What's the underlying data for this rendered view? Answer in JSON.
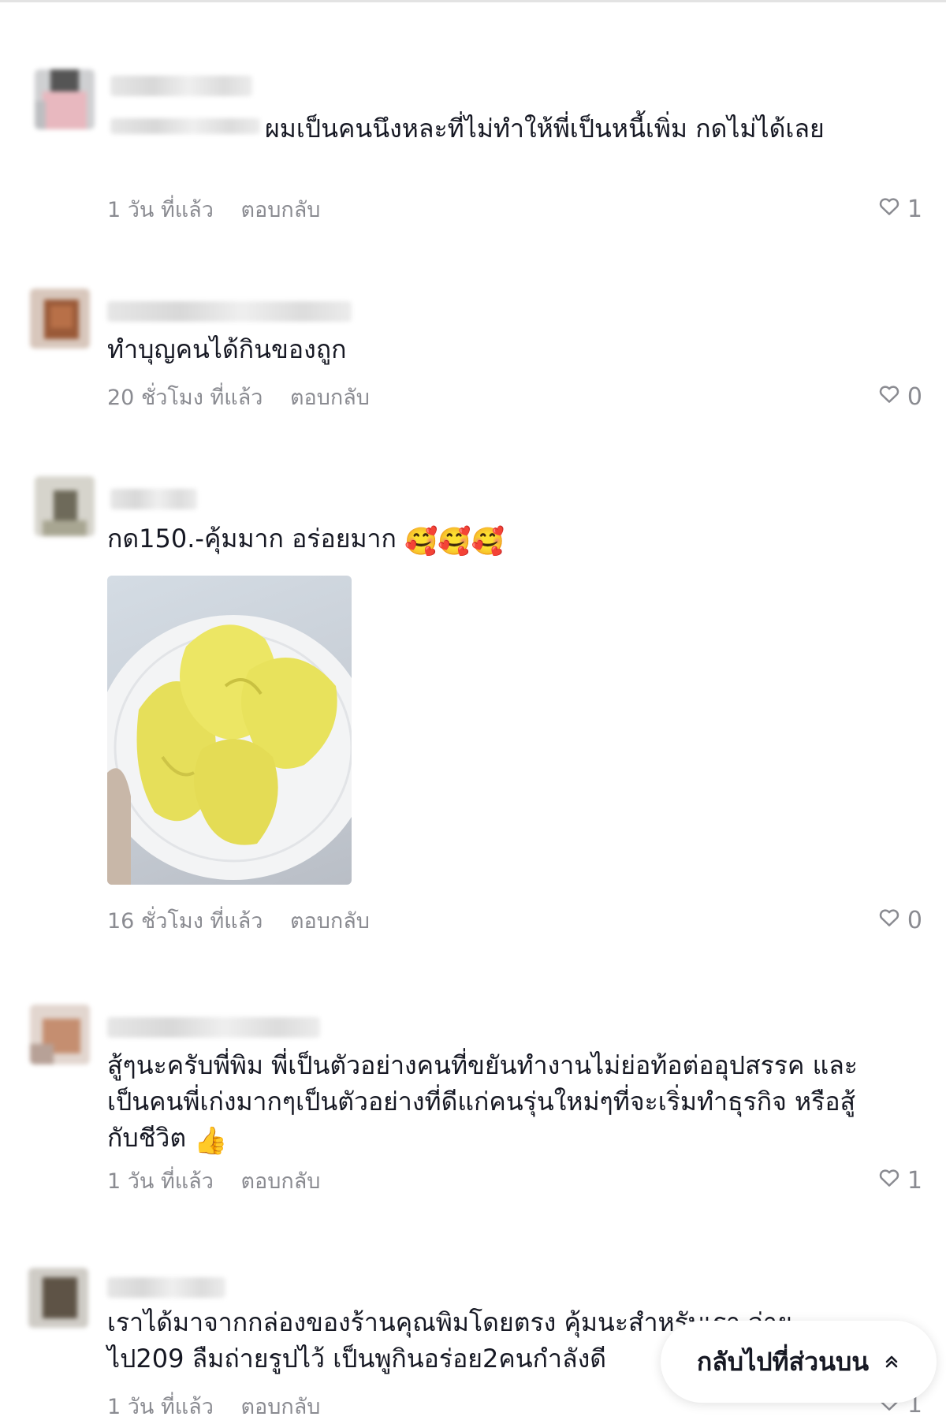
{
  "comments": [
    {
      "text": "ผมเป็นคนนึงหละที่ไม่ทำให้พี่เป็นหนี้เพิ่ม กดไม่ได้เลย",
      "time": "1 วัน ที่แล้ว",
      "reply_label": "ตอบกลับ",
      "likes": "1"
    },
    {
      "text": "ทำบุญคนได้กินของถูก",
      "time": "20 ชั่วโมง ที่แล้ว",
      "reply_label": "ตอบกลับ",
      "likes": "0"
    },
    {
      "text": "กด150.-คุ้มมาก อร่อยมาก",
      "emojis": "🥰🥰🥰",
      "time": "16 ชั่วโมง ที่แล้ว",
      "reply_label": "ตอบกลับ",
      "likes": "0"
    },
    {
      "text": "สู้ๆนะครับพี่พิม พี่เป็นตัวอย่างคนที่ขยันทำงานไม่ย่อท้อต่ออุปสรรค และเป็นคนพี่เก่งมากๆเป็นตัวอย่างที่ดีแก่คนรุ่นใหม่ๆที่จะเริ่มทำธุรกิจ หรือสู้กับชีวิต",
      "emojis": "👍",
      "time": "1 วัน ที่แล้ว",
      "reply_label": "ตอบกลับ",
      "likes": "1"
    },
    {
      "text": "เราได้มาจากกล่องของร้านคุณพิมโดยตรง คุ้มนะสำหรับเรา จ่ายไป209 ลืมถ่ายรูปไว้ เป็นพูกินอร่อย2คนกำลังดี",
      "time": "1 วัน ที่แล้ว",
      "reply_label": "ตอบกลับ",
      "likes": "1"
    }
  ],
  "back_to_top_label": "กลับไปที่ส่วนบน",
  "icons": {
    "like": "heart-outline-icon",
    "back_to_top": "double-chevron-up-icon"
  },
  "colors": {
    "text": "#161823",
    "meta": "#8a8b91"
  }
}
